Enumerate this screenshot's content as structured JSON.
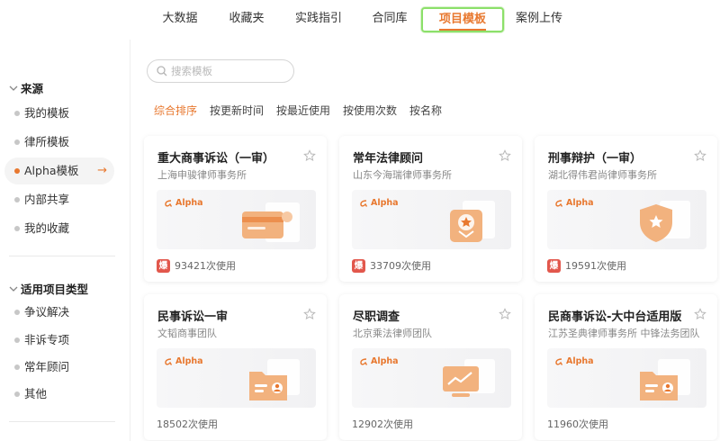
{
  "topnav": {
    "tabs": [
      {
        "label": "大数据",
        "active": false
      },
      {
        "label": "收藏夹",
        "active": false
      },
      {
        "label": "实践指引",
        "active": false
      },
      {
        "label": "合同库",
        "active": false
      },
      {
        "label": "项目模板",
        "active": true
      },
      {
        "label": "案例上传",
        "active": false
      }
    ]
  },
  "sidebar": {
    "source_title": "来源",
    "source_items": [
      {
        "label": "我的模板",
        "active": false
      },
      {
        "label": "律所模板",
        "active": false
      },
      {
        "label": "Alpha模板",
        "active": true,
        "arrow": "→"
      },
      {
        "label": "内部共享",
        "active": false
      },
      {
        "label": "我的收藏",
        "active": false
      }
    ],
    "type_title": "适用项目类型",
    "type_items": [
      {
        "label": "争议解决"
      },
      {
        "label": "非诉专项"
      },
      {
        "label": "常年顾问"
      },
      {
        "label": "其他"
      }
    ]
  },
  "search": {
    "placeholder": "搜索模板",
    "value": ""
  },
  "sort": {
    "options": [
      {
        "label": "综合排序",
        "active": true
      },
      {
        "label": "按更新时间",
        "active": false
      },
      {
        "label": "按最近使用",
        "active": false
      },
      {
        "label": "按使用次数",
        "active": false
      },
      {
        "label": "按名称",
        "active": false
      }
    ]
  },
  "colors": {
    "accent": "#e8782f",
    "hot_badge": "#e2574c",
    "active_tab_border": "#8ce06a"
  },
  "cards": [
    {
      "title": "重大商事诉讼（一审）",
      "org": "上海申骏律师事务所",
      "badge": "Alpha",
      "illustration": "card-icon",
      "hot": "爆",
      "uses": "93421次使用"
    },
    {
      "title": "常年法律顾问",
      "org": "山东今海瑞律师事务所",
      "badge": "Alpha",
      "illustration": "award-icon",
      "hot": "爆",
      "uses": "33709次使用"
    },
    {
      "title": "刑事辩护（一审）",
      "org": "湖北得伟君尚律师事务所",
      "badge": "Alpha",
      "illustration": "shield-star-icon",
      "hot": "爆",
      "uses": "19591次使用"
    },
    {
      "title": "民事诉讼一审",
      "org": "文韬商事团队",
      "badge": "Alpha",
      "illustration": "folder-user-icon",
      "hot": "",
      "uses": "18502次使用"
    },
    {
      "title": "尽职调查",
      "org": "北京乘法律师团队",
      "badge": "Alpha",
      "illustration": "monitor-chart-icon",
      "hot": "",
      "uses": "12902次使用"
    },
    {
      "title": "民商事诉讼-大中台适用版",
      "org": "江苏圣典律师事务所 中锋法务团队",
      "badge": "Alpha",
      "illustration": "folder-user-icon",
      "hot": "",
      "uses": "11960次使用"
    }
  ]
}
